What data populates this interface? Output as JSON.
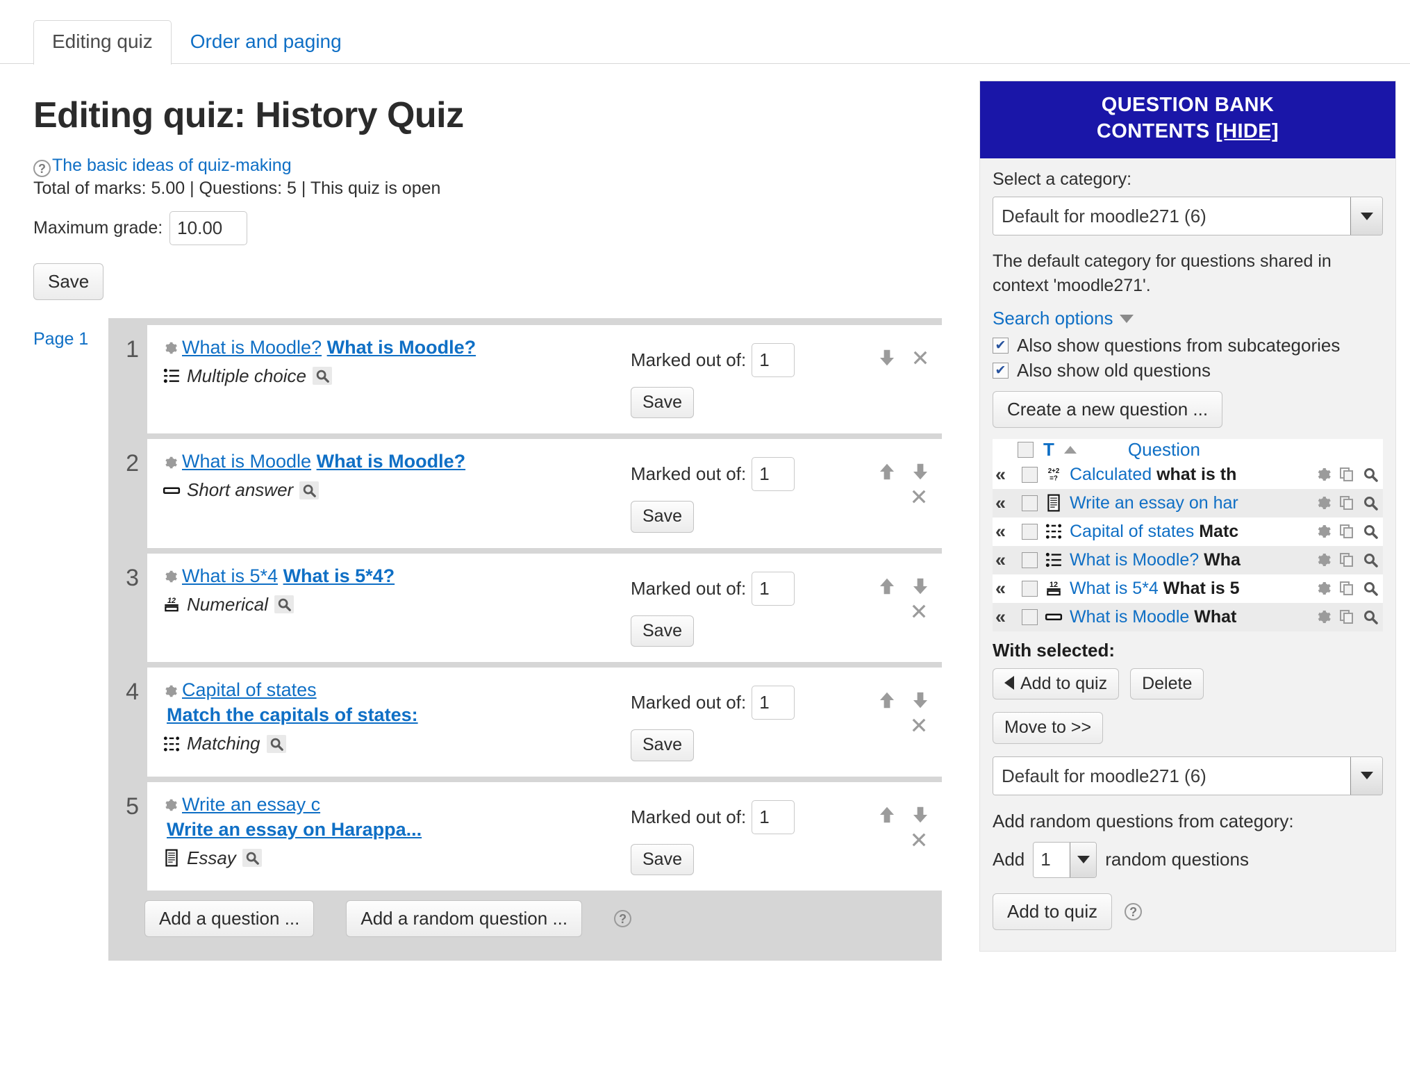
{
  "tabs": [
    {
      "label": "Editing quiz",
      "active": true
    },
    {
      "label": "Order and paging",
      "active": false
    }
  ],
  "main": {
    "title": "Editing quiz: History Quiz",
    "help_link": "The basic ideas of quiz-making",
    "summary": "Total of marks: 5.00 | Questions: 5 | This quiz is open",
    "max_grade_label": "Maximum grade:",
    "max_grade_value": "10.00",
    "save_label": "Save",
    "page_label": "Page 1",
    "marked_out_of_label": "Marked out of:",
    "row_save_label": "Save",
    "add_question_label": "Add a question ...",
    "add_random_question_label": "Add a random question ...",
    "questions": [
      {
        "num": "1",
        "name": "What is Moodle?",
        "text": "What is Moodle?",
        "type": "Multiple choice",
        "type_icon": "multiple-choice-icon",
        "marks": "1",
        "second_line": false,
        "can_move_up": false,
        "can_move_down": true,
        "delete_inline": true
      },
      {
        "num": "2",
        "name": "What is Moodle",
        "text": "What is Moodle?",
        "type": "Short answer",
        "type_icon": "short-answer-icon",
        "marks": "1",
        "second_line": false,
        "can_move_up": true,
        "can_move_down": true,
        "delete_inline": false
      },
      {
        "num": "3",
        "name": "What is 5*4",
        "text": "What is 5*4?",
        "type": "Numerical",
        "type_icon": "numerical-icon",
        "marks": "1",
        "second_line": false,
        "can_move_up": true,
        "can_move_down": true,
        "delete_inline": false
      },
      {
        "num": "4",
        "name": "Capital of states",
        "text": "Match the capitals of states:",
        "type": "Matching",
        "type_icon": "matching-icon",
        "marks": "1",
        "second_line": true,
        "can_move_up": true,
        "can_move_down": true,
        "delete_inline": false
      },
      {
        "num": "5",
        "name": "Write an essay c",
        "text": "Write an essay on Harappa...",
        "type": "Essay",
        "type_icon": "essay-icon",
        "marks": "1",
        "second_line": true,
        "can_move_up": true,
        "can_move_down": true,
        "delete_inline": false
      }
    ]
  },
  "sidebar": {
    "header_line1": "QUESTION BANK",
    "header_line2": "CONTENTS",
    "header_hide": "[HIDE]",
    "select_category_label": "Select a category:",
    "category_value": "Default for moodle271 (6)",
    "category_description": "The default category for questions shared in context 'moodle271'.",
    "search_options_label": "Search options",
    "checkbox_subcategories": "Also show questions from subcategories",
    "checkbox_old_questions": "Also show old questions",
    "checkbox_subcategories_checked": true,
    "checkbox_old_questions_checked": true,
    "create_question_label": "Create a new question ...",
    "table_header_t": "T",
    "table_header_question": "Question",
    "rows": [
      {
        "type_icon": "calculated-icon",
        "name": "Calculated ",
        "text": "what is th"
      },
      {
        "type_icon": "essay-icon",
        "name": "Write an essay on har",
        "text": ""
      },
      {
        "type_icon": "matching-icon",
        "name": "Capital of states ",
        "text": "Matc"
      },
      {
        "type_icon": "multiple-choice-icon",
        "name": "What is Moodle? ",
        "text": "Wha"
      },
      {
        "type_icon": "numerical-icon",
        "name": "What is 5*4 ",
        "text": "What is 5"
      },
      {
        "type_icon": "short-answer-icon",
        "name": "What is Moodle ",
        "text": "What"
      }
    ],
    "with_selected_label": "With selected:",
    "add_to_quiz_label": "Add to quiz",
    "delete_label": "Delete",
    "move_to_label": "Move to >>",
    "move_category_value": "Default for moodle271 (6)",
    "add_random_label": "Add random questions from category:",
    "add_word": "Add",
    "random_count": "1",
    "random_questions_label": "random questions",
    "add_to_quiz_bottom_label": "Add to quiz"
  },
  "colors": {
    "brand_blue": "#1a16a8",
    "link_blue": "#0f6fc5",
    "panel_gray": "#d6d6d6"
  }
}
